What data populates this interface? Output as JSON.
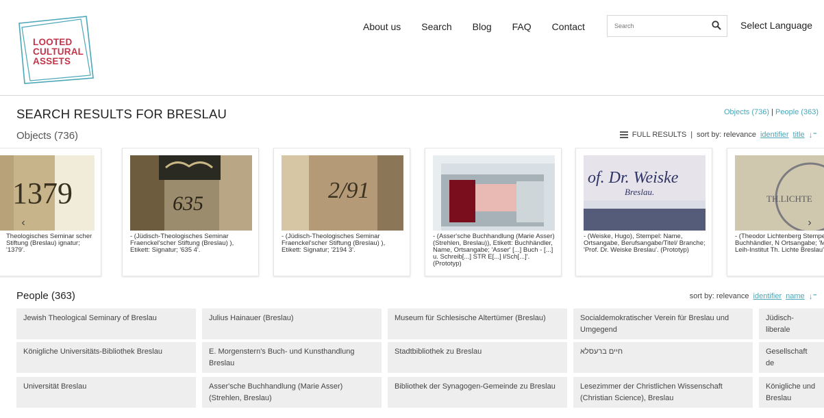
{
  "header": {
    "logo_lines": [
      "LOOTED",
      "CULTURAL",
      "ASSETS"
    ],
    "nav": [
      "About us",
      "Search",
      "Blog",
      "FAQ",
      "Contact"
    ],
    "search_placeholder": "Search",
    "language_label": "Select Language"
  },
  "results": {
    "title": "SEARCH RESULTS FOR BRESLAU",
    "links": {
      "objects": "Objects (736)",
      "separator": "|",
      "people": "People (363)"
    }
  },
  "objects": {
    "title": "Objects (736)",
    "full_results": "FULL RESULTS",
    "separator": "|",
    "sort_label": "sort by: relevance",
    "sort_identifier": "identifier",
    "sort_title": "title",
    "cards": [
      {
        "caption": "Theologisches Seminar scher Stiftung (Breslau) ignatur; '1379'."
      },
      {
        "caption": "- (Jüdisch-Theologisches Seminar Fraenckel'scher Stiftung (Breslau) ), Etikett: Signatur; '635 4'."
      },
      {
        "caption": "- (Jüdisch-Theologisches Seminar Fraenckel'scher Stiftung (Breslau) ), Etikett: Signatur; '2194 3'."
      },
      {
        "caption": "- (Asser'sche Buchhandlung (Marie Asser) (Strehlen, Breslau)), Etikett: Buchhändler, Name, Ortsangabe; 'Asser' [...] Buch - [...] u. Schreib[...] STR E[...] l/Sch[...]'. (Prototyp)"
      },
      {
        "caption": "- (Weiske, Hugo), Stempel: Name, Ortsangabe, Berufsangabe/Titel/ Branche; 'Prof. Dr. Weiske Breslau'. (Prototyp)"
      },
      {
        "caption": "- (Theodor Lichtenberg Stempel: Buchhändler, N Ortsangabe; 'Musikalien & Leih-Institut Th. Lichte Breslau'. (Prototyp)"
      }
    ]
  },
  "people": {
    "title": "People (363)",
    "sort_label": "sort by: relevance",
    "sort_identifier": "identifier",
    "sort_name": "name",
    "rows": [
      [
        "Jewish Theological Seminary of Breslau",
        "Julius Hainauer (Breslau)",
        "Museum für Schlesische Altertümer (Breslau)",
        "Socialdemokratischer Verein für Breslau und Umgegend",
        "Jüdisch-liberale"
      ],
      [
        "Königliche Universitäts-Bibliothek Breslau",
        "E. Morgenstern's Buch- und Kunsthandlung Breslau",
        "Stadtbibliothek zu Breslau",
        "חיים ברעסלא",
        "Gesellschaft de"
      ],
      [
        "Universität Breslau",
        "Asser'sche Buchhandlung (Marie Asser) (Strehlen, Breslau)",
        "Bibliothek der Synagogen-Gemeinde zu Breslau",
        "Lesezimmer der Christlichen Wissenschaft (Christian Science), Breslau",
        "Königliche und Breslau"
      ]
    ]
  },
  "colors": {
    "accent": "#4aa6b8",
    "logo_red": "#c4344a",
    "logo_teal": "#4aa6b8",
    "cell_bg": "#eeeeee"
  },
  "icons": {
    "search": "search-icon",
    "list": "list-icon",
    "sort": "sort-arrow-icon",
    "prev": "chevron-left-icon",
    "next": "chevron-right-icon"
  }
}
